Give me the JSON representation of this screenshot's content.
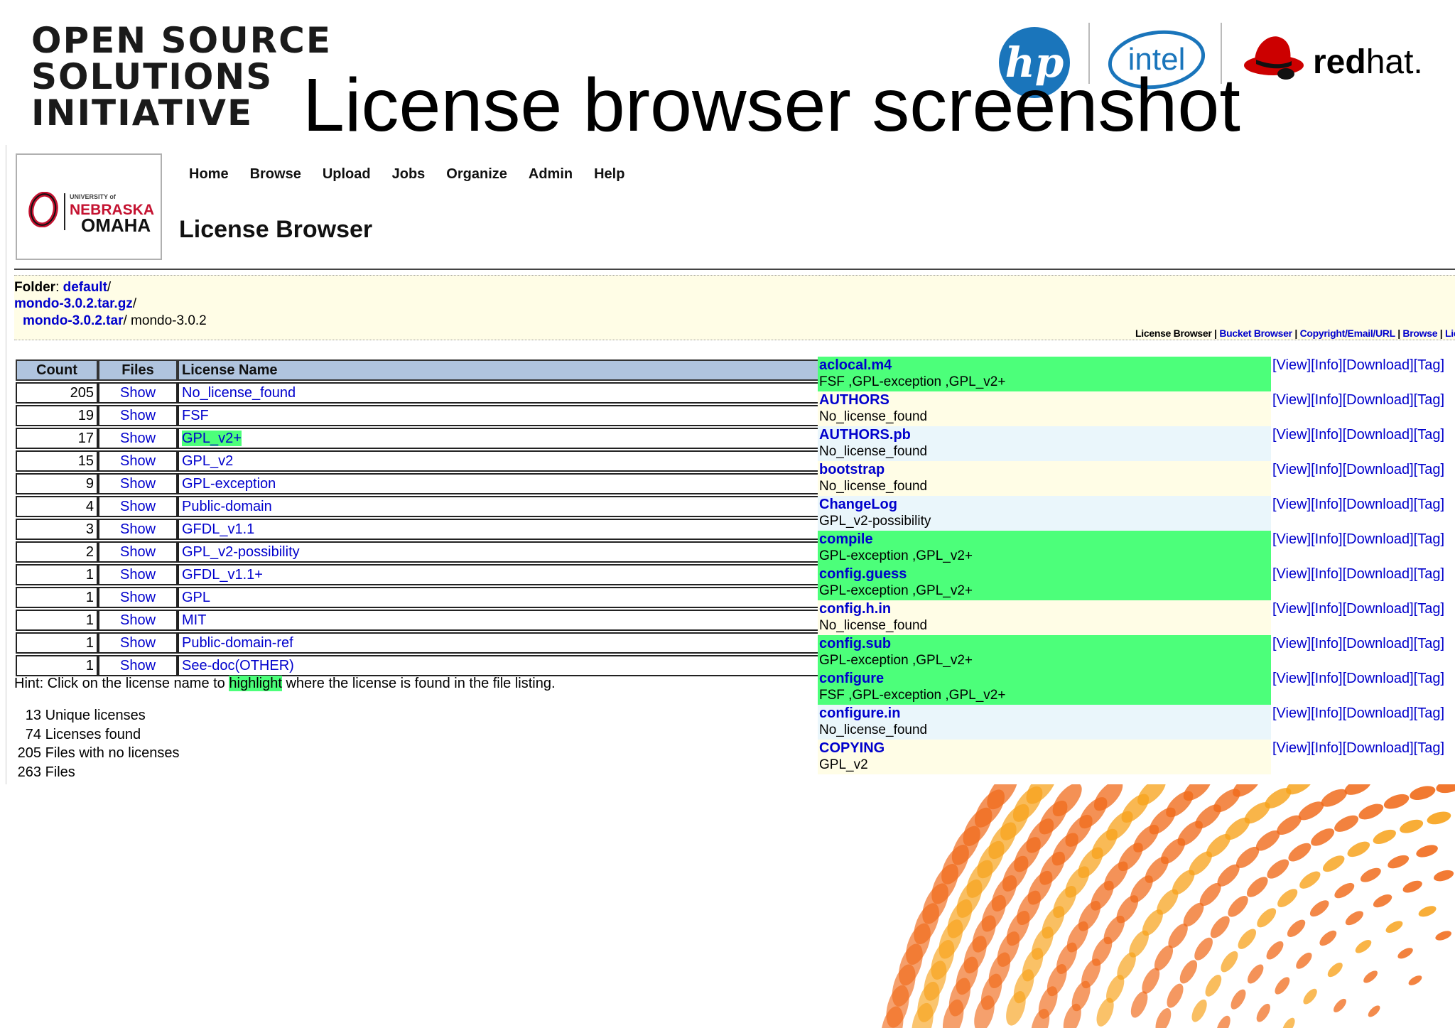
{
  "slide": {
    "title": "License browser screenshot",
    "osi_logo_lines": [
      "OPEN SOURCE",
      "SOLUTIONS",
      "INITIATIVE"
    ],
    "sponsor_logos": {
      "hp": "hp",
      "intel": "intel",
      "redhat_bold": "red",
      "redhat_light": "hat."
    }
  },
  "screenshot": {
    "university_logo": {
      "small": "UNIVERSITY of",
      "name": "NEBRASKA",
      "city": "OMAHA"
    },
    "nav": [
      "Home",
      "Browse",
      "Upload",
      "Jobs",
      "Organize",
      "Admin",
      "Help"
    ],
    "page_heading": "License Browser",
    "folder": {
      "label": "Folder",
      "root": "default",
      "archive": "mondo-3.0.2.tar.gz",
      "tar": "mondo-3.0.2.tar",
      "current": "mondo-3.0.2"
    },
    "sub_links": [
      "License Browser",
      "Bucket Browser",
      "Copyright/Email/URL",
      "Browse",
      "Lic"
    ],
    "table": {
      "headers": [
        "Count",
        "Files",
        "License Name"
      ],
      "rows": [
        {
          "count": "205",
          "files": "Show",
          "name": "No_license_found"
        },
        {
          "count": "19",
          "files": "Show",
          "name": "FSF"
        },
        {
          "count": "17",
          "files": "Show",
          "name": "GPL_v2+"
        },
        {
          "count": "15",
          "files": "Show",
          "name": "GPL_v2"
        },
        {
          "count": "9",
          "files": "Show",
          "name": "GPL-exception"
        },
        {
          "count": "4",
          "files": "Show",
          "name": "Public-domain"
        },
        {
          "count": "3",
          "files": "Show",
          "name": "GFDL_v1.1"
        },
        {
          "count": "2",
          "files": "Show",
          "name": "GPL_v2-possibility"
        },
        {
          "count": "1",
          "files": "Show",
          "name": "GFDL_v1.1+"
        },
        {
          "count": "1",
          "files": "Show",
          "name": "GPL"
        },
        {
          "count": "1",
          "files": "Show",
          "name": "MIT"
        },
        {
          "count": "1",
          "files": "Show",
          "name": "Public-domain-ref"
        },
        {
          "count": "1",
          "files": "Show",
          "name": "See-doc(OTHER)"
        }
      ],
      "highlighted_license": "GPL_v2+"
    },
    "hint": {
      "before": "Hint: Click on the license name to",
      "highlight": "highlight",
      "after": "where the license is found in the file listing."
    },
    "stats": [
      {
        "num": "13",
        "label": "Unique licenses"
      },
      {
        "num": "74",
        "label": "Licenses found"
      },
      {
        "num": "205",
        "label": "Files with no licenses"
      },
      {
        "num": "263",
        "label": "Files"
      }
    ],
    "actions": [
      "[View]",
      "[Info]",
      "[Download]",
      "[Tag]"
    ],
    "files": [
      {
        "name": "aclocal.m4",
        "licenses": "FSF ,GPL-exception ,GPL_v2+",
        "bg": "#4cff7a"
      },
      {
        "name": "AUTHORS",
        "licenses": "No_license_found",
        "bg": "#fffde6"
      },
      {
        "name": "AUTHORS.pb",
        "licenses": "No_license_found",
        "bg": "#eaf6fb"
      },
      {
        "name": "bootstrap",
        "licenses": "No_license_found",
        "bg": "#fffde6"
      },
      {
        "name": "ChangeLog",
        "licenses": "GPL_v2-possibility",
        "bg": "#eaf6fb"
      },
      {
        "name": "compile",
        "licenses": "GPL-exception ,GPL_v2+",
        "bg": "#4cff7a"
      },
      {
        "name": "config.guess",
        "licenses": "GPL-exception ,GPL_v2+",
        "bg": "#4cff7a"
      },
      {
        "name": "config.h.in",
        "licenses": "No_license_found",
        "bg": "#fffde6"
      },
      {
        "name": "config.sub",
        "licenses": "GPL-exception ,GPL_v2+",
        "bg": "#4cff7a"
      },
      {
        "name": "configure",
        "licenses": "FSF ,GPL-exception ,GPL_v2+",
        "bg": "#4cff7a"
      },
      {
        "name": "configure.in",
        "licenses": "No_license_found",
        "bg": "#eaf6fb"
      },
      {
        "name": "COPYING",
        "licenses": "GPL_v2",
        "bg": "#fffde6"
      }
    ]
  },
  "colors": {
    "link": "#0000cc",
    "highlight": "#4cff7a",
    "header_bg": "#b0c4de",
    "accent_orange": "#f06a1a",
    "accent_yellow": "#f7a21b"
  }
}
